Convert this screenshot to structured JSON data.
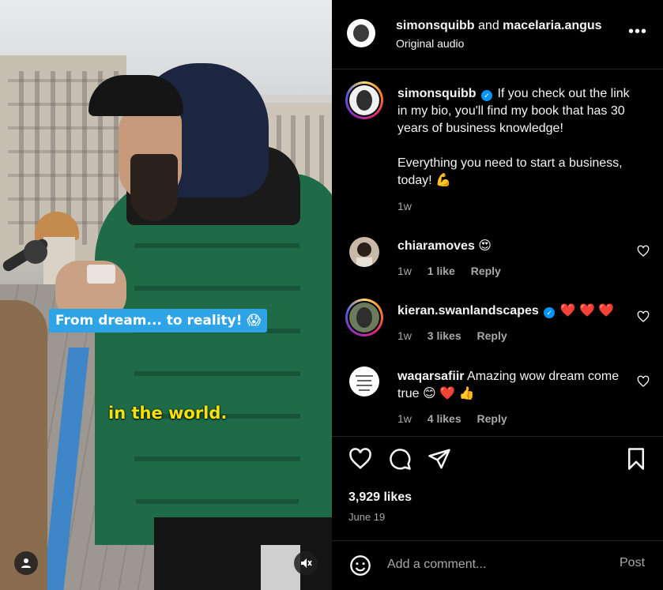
{
  "video": {
    "caption_top": "From dream... to reality! 😱",
    "caption_bottom": "in the world.",
    "icons": {
      "user": "person-icon",
      "mute": "speaker-muted-icon"
    }
  },
  "header": {
    "user1": "simonsquibb",
    "joiner": "and",
    "user2": "macelaria.angus",
    "audio": "Original audio",
    "more_label": "•••"
  },
  "post": {
    "author": "simonsquibb",
    "caption_line1": "If you check out the link in my bio, you'll find my book that has 30 years of business knowledge!",
    "caption_line2": "Everything you need to start a business, today! 💪",
    "age": "1w"
  },
  "comments": [
    {
      "user": "chiaramoves",
      "text": "😍",
      "age": "1w",
      "likes": "1 like",
      "reply": "Reply"
    },
    {
      "user": "kieran.swanlandscapes",
      "text": "❤️ ❤️ ❤️",
      "age": "1w",
      "likes": "3 likes",
      "reply": "Reply"
    },
    {
      "user": "waqarsafiir",
      "text": "Amazing wow dream come true 😊 ❤️ 👍",
      "age": "1w",
      "likes": "4 likes",
      "reply": "Reply"
    }
  ],
  "stats": {
    "likes": "3,929 likes",
    "date": "June 19"
  },
  "composer": {
    "placeholder": "Add a comment...",
    "post_label": "Post"
  },
  "colors": {
    "verified": "#0095f6",
    "caption_bg": "#2ea3e6",
    "caption_yellow": "#f5e20a",
    "heart_red": "#ff3040"
  }
}
